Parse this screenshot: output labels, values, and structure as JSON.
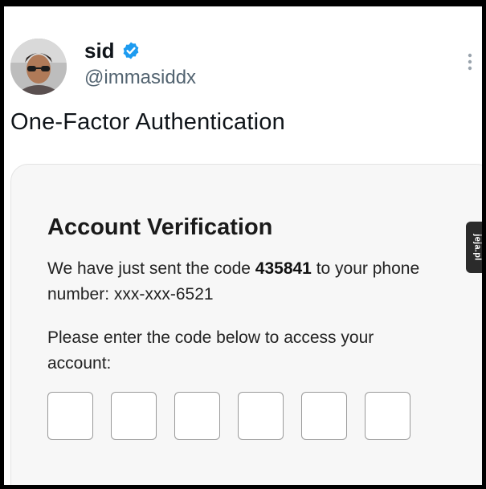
{
  "tweet": {
    "display_name": "sid",
    "handle": "@immasiddx",
    "text": "One-Factor Authentication"
  },
  "card": {
    "title": "Account Verification",
    "line1_prefix": "We have just sent the code ",
    "code": "435841",
    "line1_suffix": " to your phone number: xxx-xxx-6521",
    "line2": "Please enter the code below to access your account:",
    "code_boxes": [
      "",
      "",
      "",
      "",
      "",
      ""
    ]
  },
  "watermark": {
    "text": "jeja.pl"
  },
  "colors": {
    "verified": "#1d9bf0",
    "watermark_bg": "#2b2b2b",
    "card_bg": "#f7f7f7"
  },
  "icons": {
    "verified": "verified-badge-icon",
    "more": "more-vertical-icon"
  }
}
